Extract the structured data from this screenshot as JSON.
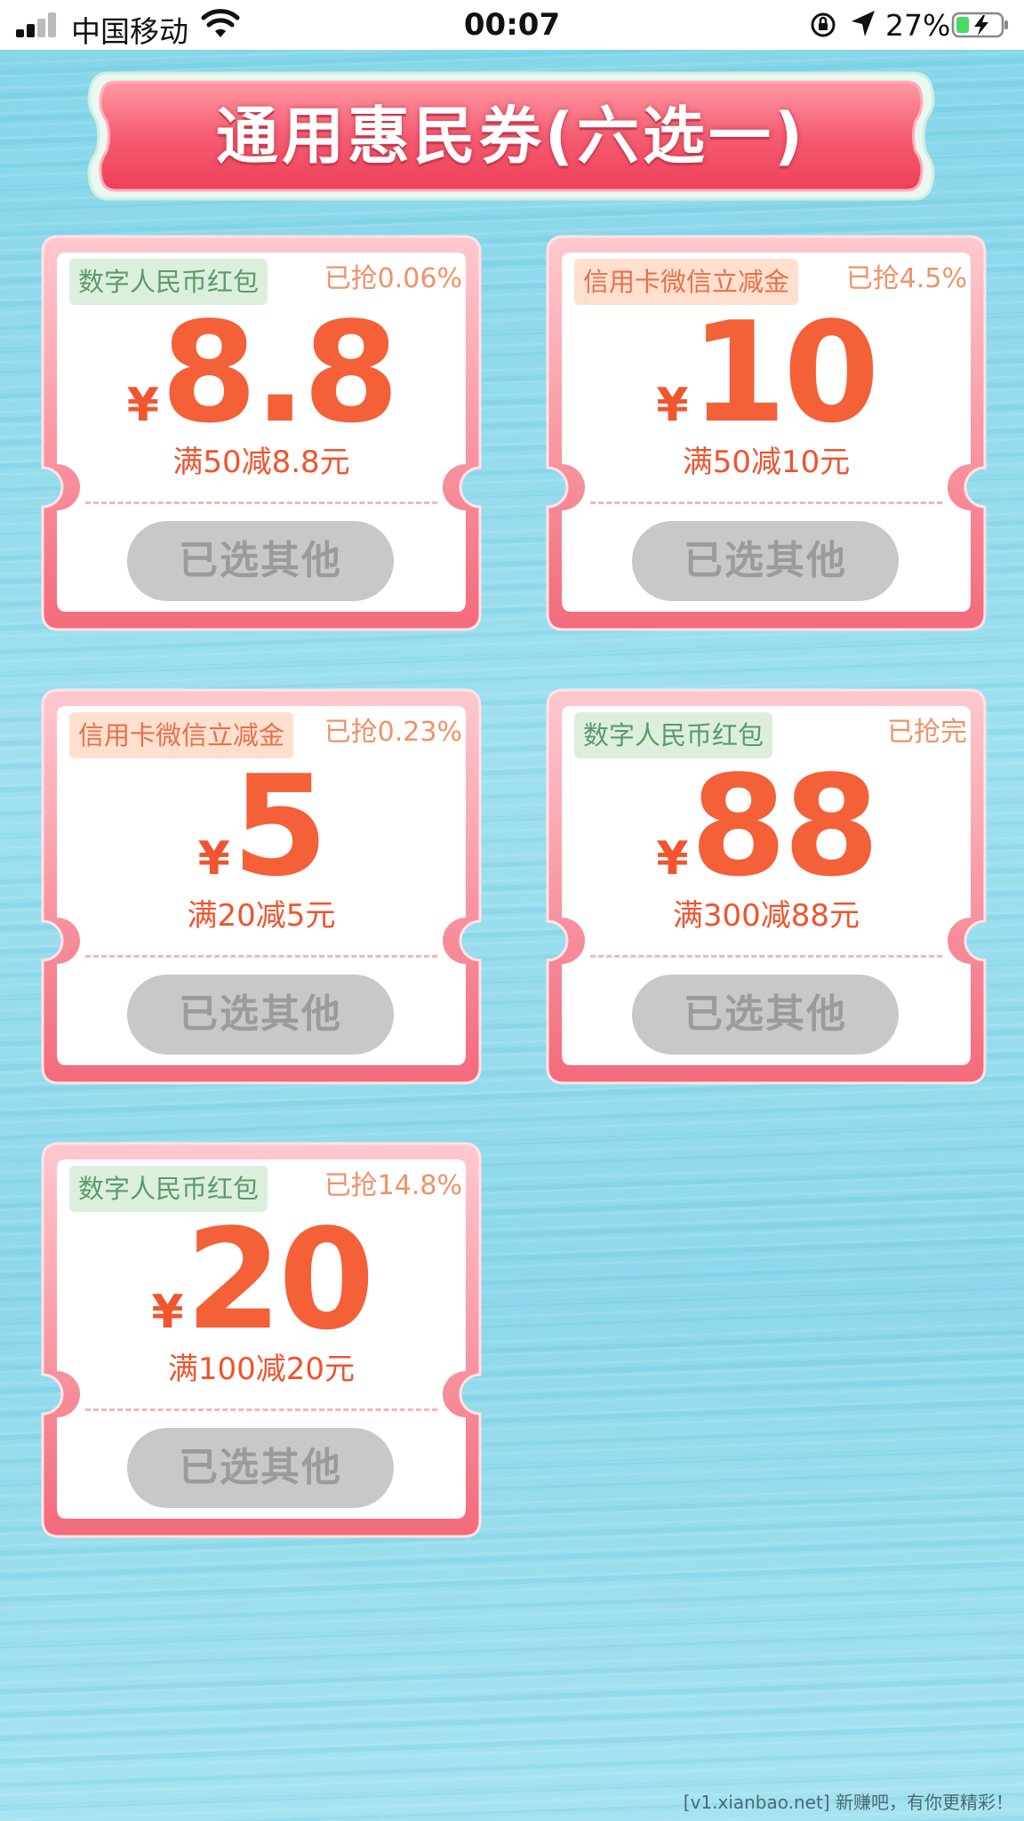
{
  "status_bar": {
    "carrier": "中国移动",
    "time": "00:07",
    "battery_percent": "27%",
    "icons": [
      "signal-icon",
      "wifi-icon",
      "rotation-lock-icon",
      "location-arrow-icon",
      "battery-charging-icon"
    ]
  },
  "header": {
    "title": "通用惠民券(六选一)"
  },
  "coupons": [
    {
      "tag": "数字人民币红包",
      "tag_color": "green",
      "grabbed": "已抢0.06%",
      "currency": "¥",
      "amount": "8.8",
      "rule": "满50减8.8元",
      "button": "已选其他"
    },
    {
      "tag": "信用卡微信立减金",
      "tag_color": "orange",
      "grabbed": "已抢4.5%",
      "currency": "¥",
      "amount": "10",
      "rule": "满50减10元",
      "button": "已选其他"
    },
    {
      "tag": "信用卡微信立减金",
      "tag_color": "orange",
      "grabbed": "已抢0.23%",
      "currency": "¥",
      "amount": "5",
      "rule": "满20减5元",
      "button": "已选其他"
    },
    {
      "tag": "数字人民币红包",
      "tag_color": "green",
      "grabbed": "已抢完",
      "currency": "¥",
      "amount": "88",
      "rule": "满300减88元",
      "button": "已选其他"
    },
    {
      "tag": "数字人民币红包",
      "tag_color": "green",
      "grabbed": "已抢14.8%",
      "currency": "¥",
      "amount": "20",
      "rule": "满100减20元",
      "button": "已选其他"
    }
  ],
  "colors": {
    "banner": "#f4546a",
    "amount": "#f46038",
    "frame": "#f77f8e",
    "button_disabled": "#c8c8c8",
    "background": "#8fd9ea"
  },
  "watermark": "[v1.xianbao.net] 新赚吧，有你更精彩！"
}
